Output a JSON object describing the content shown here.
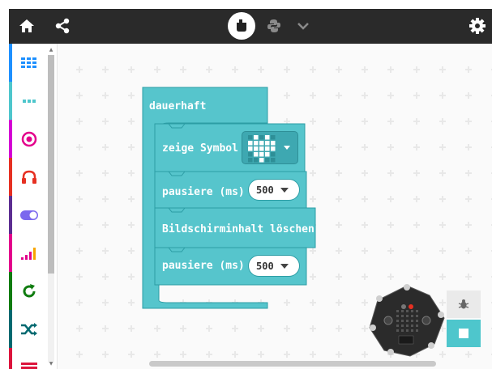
{
  "colors": {
    "topbar": "#2a2a2a",
    "block": "#56c5cc",
    "block_dark": "#2c9da5",
    "workspace": "#fafafa"
  },
  "topbar": {
    "home_icon": "home-icon",
    "share_icon": "share-icon",
    "blocks_icon": "blocks-icon",
    "python_icon": "python-icon",
    "more_icon": "chevron-down-icon",
    "settings_icon": "gear-icon"
  },
  "toolbox": {
    "categories": [
      {
        "name": "basic",
        "icon": "grid-icon",
        "color": "#1e90ff"
      },
      {
        "name": "more",
        "icon": "more-dots-icon",
        "color": "#4ec6cc"
      },
      {
        "name": "input",
        "icon": "target-icon",
        "color": "#d400d4"
      },
      {
        "name": "music",
        "icon": "headphones-icon",
        "color": "#e63022"
      },
      {
        "name": "led",
        "icon": "toggle-icon",
        "color": "#5c2d91"
      },
      {
        "name": "radio",
        "icon": "signal-icon",
        "color": "#e3008c"
      },
      {
        "name": "loops",
        "icon": "loop-icon",
        "color": "#107c10"
      },
      {
        "name": "logic",
        "icon": "shuffle-icon",
        "color": "#006970"
      },
      {
        "name": "variables",
        "icon": "list-icon",
        "color": "#dc143c"
      }
    ]
  },
  "blocks": {
    "forever": "dauerhaft",
    "show_icon": "zeige Symbol",
    "pause1_label": "pausiere (ms)",
    "pause1_value": "500",
    "clear": "Bildschirminhalt löschen",
    "pause2_label": "pausiere (ms)",
    "pause2_value": "500",
    "symbol": "heart"
  },
  "simulator": {
    "debug_icon": "bug-icon",
    "stop_icon": "stop-icon",
    "device": "calliope-mini"
  }
}
